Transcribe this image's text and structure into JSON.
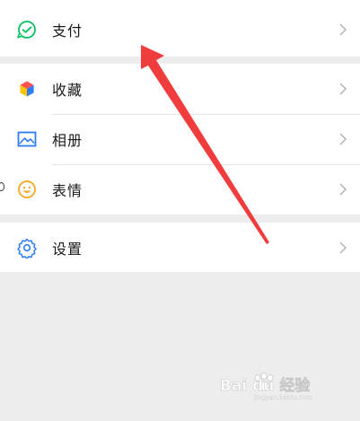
{
  "menu": {
    "items": [
      {
        "label": "支付",
        "icon": "pay-icon"
      },
      {
        "label": "收藏",
        "icon": "favorites-icon"
      },
      {
        "label": "相册",
        "icon": "album-icon"
      },
      {
        "label": "表情",
        "icon": "sticker-icon"
      },
      {
        "label": "设置",
        "icon": "settings-icon"
      }
    ]
  },
  "watermark": {
    "text": "Bai du 经验",
    "sub": "jingyan.baidu.com"
  },
  "colors": {
    "pay_green": "#07c160",
    "settings_blue": "#2e7cf6",
    "arrow_red": "#f03c3c",
    "background": "#ededed"
  }
}
